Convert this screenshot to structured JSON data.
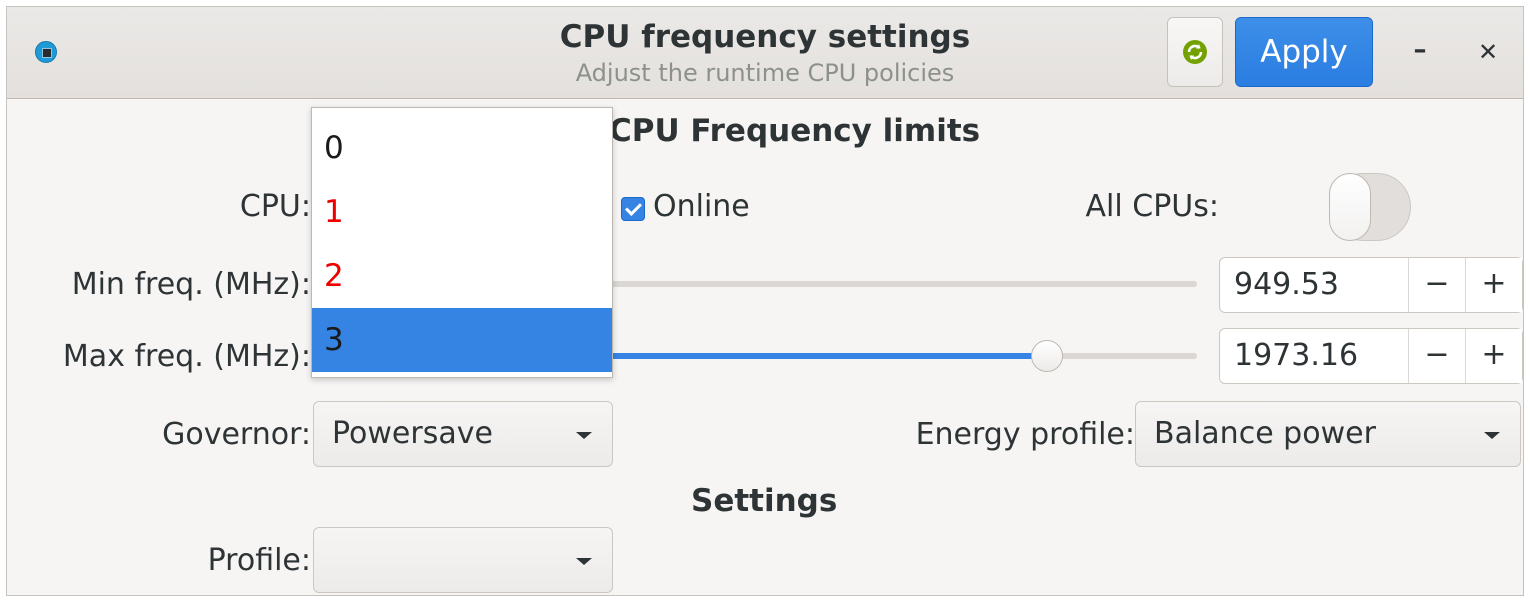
{
  "header": {
    "title": "CPU frequency settings",
    "subtitle": "Adjust the runtime CPU policies",
    "apply_label": "Apply",
    "minimize_glyph": "–",
    "close_glyph": "✕"
  },
  "limits": {
    "heading": "CPU Frequency limits",
    "cpu_label": "CPU:",
    "online_label": "Online",
    "online_checked": true,
    "all_cpus_label": "All CPUs:",
    "all_cpus_on": false,
    "min_freq_label": "Min freq. (MHz):",
    "min_freq_value": "949.53",
    "max_freq_label": "Max freq. (MHz):",
    "max_freq_value": "1973.16",
    "decrement_glyph": "−",
    "increment_glyph": "+",
    "governor_label": "Governor:",
    "governor_value": "Powersave",
    "energy_label": "Energy profile:",
    "energy_value": "Balance power"
  },
  "settings": {
    "heading": "Settings",
    "profile_label": "Profile:",
    "profile_value": ""
  },
  "cpu_dropdown": {
    "items": [
      {
        "label": "0",
        "color": "#1a1a1a"
      },
      {
        "label": "1",
        "color": "#ee0000"
      },
      {
        "label": "2",
        "color": "#ee0000"
      },
      {
        "label": "3",
        "color": "#1a1a1a",
        "selected": true
      }
    ]
  },
  "colors": {
    "accent": "#3584e4",
    "refresh_icon": "#73a100"
  }
}
